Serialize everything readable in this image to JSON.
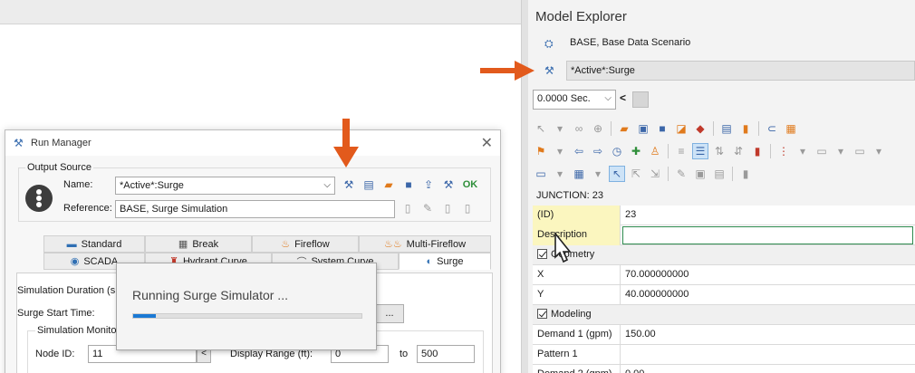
{
  "explorer": {
    "title": "Model Explorer",
    "scenarios": [
      {
        "label": "BASE, Base Data Scenario"
      },
      {
        "label": "*Active*:Surge"
      }
    ],
    "time": {
      "value": "0.0000 Sec.",
      "prev": "<"
    },
    "element_header": "JUNCTION: 23",
    "properties": [
      {
        "name": "(ID)",
        "value": "23",
        "kind": "field",
        "highlight": true
      },
      {
        "name": "Description",
        "value": "",
        "kind": "input",
        "highlight": true
      },
      {
        "name": "Geometry",
        "value": "",
        "kind": "category"
      },
      {
        "name": "X",
        "value": "70.000000000",
        "kind": "field"
      },
      {
        "name": "Y",
        "value": "40.000000000",
        "kind": "field"
      },
      {
        "name": "Modeling",
        "value": "",
        "kind": "category"
      },
      {
        "name": "Demand 1 (gpm)",
        "value": "150.00",
        "kind": "field"
      },
      {
        "name": "Pattern 1",
        "value": "",
        "kind": "field"
      },
      {
        "name": "Demand 2 (gpm)",
        "value": "0.00",
        "kind": "field"
      }
    ]
  },
  "run_manager": {
    "title": "Run Manager",
    "close": "✕",
    "output_source": {
      "legend": "Output Source",
      "name_label": "Name:",
      "name_value": "*Active*:Surge",
      "reference_label": "Reference:",
      "reference_value": "BASE, Surge Simulation",
      "ok_label": "OK"
    },
    "tabs": [
      {
        "label": "Standard",
        "icon": "folder-icon",
        "glyph": "▬",
        "color": "#2f6fb3"
      },
      {
        "label": "Break",
        "icon": "break-icon",
        "glyph": "▦",
        "color": "#555555"
      },
      {
        "label": "Fireflow",
        "icon": "flame-icon",
        "glyph": "♨",
        "color": "#e07a1c"
      },
      {
        "label": "Multi-Fireflow",
        "icon": "multi-flame-icon",
        "glyph": "♨♨",
        "color": "#e07a1c"
      },
      {
        "label": "SCADA",
        "icon": "scada-icon",
        "glyph": "◉",
        "color": "#2f6fb3"
      },
      {
        "label": "Hydrant Curve",
        "icon": "hydrant-icon",
        "glyph": "♜",
        "color": "#c0392b"
      },
      {
        "label": "System Curve",
        "icon": "curve-icon",
        "glyph": "⌒",
        "color": "#555555"
      },
      {
        "label": "Surge",
        "icon": "surge-icon",
        "glyph": "◐",
        "color": "#2f6fb3"
      }
    ],
    "simulation_duration_label": "Simulation Duration (s",
    "surge_start_label": "Surge Start Time:",
    "ellipsis": "...",
    "monitoring": {
      "legend": "Simulation Monitori",
      "node_label": "Node ID:",
      "node_value": "11",
      "range_label": "Display Range (ft):",
      "range_min": "0",
      "to_label": "to",
      "range_max": "500"
    }
  },
  "progress": {
    "text": "Running Surge Simulator ...",
    "fraction": 0.1
  },
  "colors": {
    "arrow": "#e25a1c",
    "accent": "#1b79d4"
  }
}
